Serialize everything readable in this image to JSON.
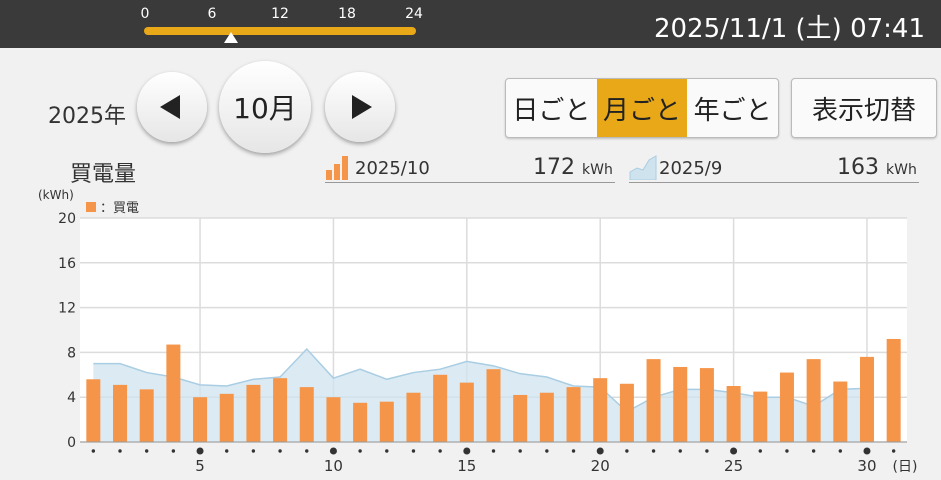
{
  "header": {
    "timeline_ticks": [
      "0",
      "6",
      "12",
      "18",
      "24"
    ],
    "timeline_progress": 0.32,
    "datetime": "2025/11/1 (土) 07:41"
  },
  "nav": {
    "year_label": "2025年",
    "prev_icon": "triangle-left-icon",
    "month_label": "10月",
    "next_icon": "triangle-right-icon"
  },
  "view_modes": {
    "daily": "日ごと",
    "monthly": "月ごと",
    "yearly": "年ごと",
    "selected": "monthly"
  },
  "switch_button": "表示切替",
  "summary": {
    "title": "買電量",
    "current_label": "2025/10",
    "current_value": "172",
    "prev_label": "2025/9",
    "prev_value": "163",
    "unit": "kWh"
  },
  "colors": {
    "accent": "#e8a817",
    "bar": "#f5954a",
    "prev_area": "#cfe3ef",
    "prev_line": "#a9cde3"
  },
  "chart_data": {
    "type": "bar",
    "ylabel": "(kWh)",
    "ylim": [
      0,
      20
    ],
    "yticks": [
      0,
      4,
      8,
      12,
      16,
      20
    ],
    "xlabel": "(日)",
    "xtick_labels": [
      "5",
      "10",
      "15",
      "20",
      "25",
      "30"
    ],
    "legend": "：買電",
    "x": [
      1,
      2,
      3,
      4,
      5,
      6,
      7,
      8,
      9,
      10,
      11,
      12,
      13,
      14,
      15,
      16,
      17,
      18,
      19,
      20,
      21,
      22,
      23,
      24,
      25,
      26,
      27,
      28,
      29,
      30,
      31
    ],
    "series": [
      {
        "name": "買電",
        "values": [
          5.6,
          5.1,
          4.7,
          8.7,
          4.0,
          4.3,
          5.1,
          5.7,
          4.9,
          4.0,
          3.5,
          3.6,
          4.4,
          6.0,
          5.3,
          6.5,
          4.2,
          4.4,
          4.9,
          5.7,
          5.2,
          7.4,
          6.7,
          6.6,
          5.0,
          4.5,
          6.2,
          7.4,
          5.4,
          7.6,
          9.2
        ]
      },
      {
        "name": "2025/9",
        "type": "area",
        "values": [
          7.0,
          7.0,
          6.2,
          5.8,
          5.1,
          5.0,
          5.6,
          5.8,
          8.3,
          5.7,
          6.5,
          5.6,
          6.2,
          6.5,
          7.2,
          6.8,
          6.1,
          5.8,
          5.0,
          4.9,
          2.7,
          4.0,
          4.7,
          4.7,
          4.4,
          4.0,
          4.0,
          3.2,
          4.7,
          4.8
        ]
      }
    ]
  }
}
